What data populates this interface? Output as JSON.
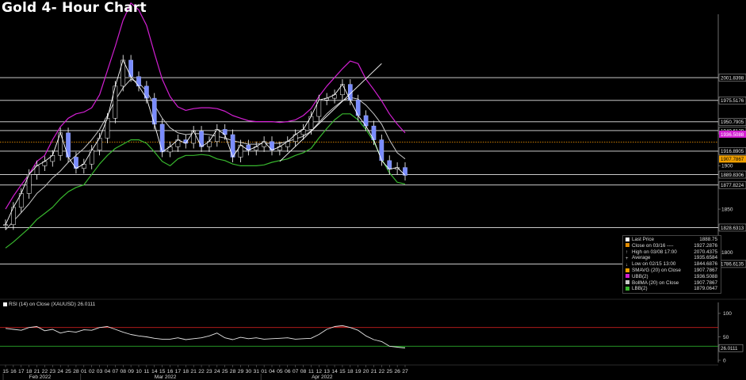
{
  "title": "Gold 4- Hour Chart",
  "colors": {
    "price": "#ffffff",
    "ubb": "#d21fd2",
    "lbb": "#38b82e",
    "sma": "#c8c8c8",
    "trend": "#ffffff",
    "rsi": "#e6e6e6",
    "rsi_upper": "#c81e1e",
    "rsi_lower": "#2aa82a",
    "close_line": "#e08a00",
    "tag_bg": "#ffffff",
    "tag_text": "#000000",
    "tag_sma": "#f0a000",
    "tag_ubb": "#d21fd2"
  },
  "chart_data": {
    "type": "line",
    "title": "Gold 4- Hour Chart",
    "ylim": [
      1755,
      2075
    ],
    "xlabel": "",
    "ylabel": "",
    "ticks": [
      "15",
      "16",
      "17",
      "18",
      "21",
      "22",
      "23",
      "24",
      "25",
      "28",
      "01",
      "02",
      "03",
      "04",
      "07",
      "08",
      "09",
      "10",
      "11",
      "14",
      "15",
      "16",
      "17",
      "18",
      "21",
      "22",
      "23",
      "24",
      "25",
      "28",
      "29",
      "30",
      "31",
      "01",
      "04",
      "05",
      "06",
      "07",
      "08",
      "11",
      "12",
      "13",
      "14",
      "15",
      "18",
      "19",
      "20",
      "21",
      "22",
      "25",
      "26",
      "27"
    ],
    "months": [
      {
        "label": "Feb 2022",
        "tick_index": 4
      },
      {
        "label": "Mar 2022",
        "tick_index": 20
      },
      {
        "label": "Apr 2022",
        "tick_index": 40
      }
    ],
    "y_ticks": [
      1800,
      1850,
      1900
    ],
    "series": [
      {
        "name": "Last Price",
        "values": [
          1832,
          1852,
          1868,
          1890,
          1900,
          1905,
          1912,
          1938,
          1910,
          1897,
          1902,
          1918,
          1932,
          1955,
          1992,
          2022,
          2003,
          1992,
          1978,
          1948,
          1916,
          1922,
          1930,
          1926,
          1940,
          1922,
          1928,
          1942,
          1936,
          1910,
          1924,
          1918,
          1922,
          1928,
          1918,
          1922,
          1928,
          1936,
          1942,
          1957,
          1976,
          1978,
          1982,
          1994,
          1976,
          1958,
          1946,
          1930,
          1906,
          1896,
          1898,
          1889
        ]
      },
      {
        "name": "SMAVG (20)  on Close",
        "values": [
          1826,
          1836,
          1846,
          1856,
          1868,
          1876,
          1886,
          1894,
          1904,
          1912,
          1920,
          1930,
          1942,
          1958,
          1976,
          1990,
          2000,
          1996,
          1986,
          1970,
          1955,
          1944,
          1938,
          1936,
          1937,
          1937,
          1936,
          1934,
          1932,
          1929,
          1927,
          1925,
          1925,
          1926,
          1926,
          1926,
          1928,
          1931,
          1934,
          1940,
          1950,
          1960,
          1968,
          1975,
          1979,
          1977,
          1970,
          1960,
          1948,
          1930,
          1915,
          1908
        ]
      },
      {
        "name": "UBB(2)",
        "values": [
          1850,
          1865,
          1878,
          1890,
          1905,
          1912,
          1930,
          1945,
          1955,
          1960,
          1962,
          1967,
          1982,
          2010,
          2038,
          2068,
          2088,
          2080,
          2062,
          2030,
          2000,
          1980,
          1968,
          1964,
          1966,
          1967,
          1967,
          1966,
          1963,
          1958,
          1955,
          1952,
          1951,
          1951,
          1951,
          1950,
          1951,
          1953,
          1958,
          1966,
          1980,
          1992,
          2002,
          2012,
          2021,
          2018,
          2000,
          1988,
          1975,
          1960,
          1948,
          1938
        ]
      },
      {
        "name": "LBB(2)",
        "values": [
          1805,
          1812,
          1820,
          1828,
          1838,
          1845,
          1852,
          1862,
          1870,
          1875,
          1878,
          1890,
          1902,
          1912,
          1920,
          1925,
          1930,
          1930,
          1926,
          1916,
          1905,
          1900,
          1908,
          1912,
          1912,
          1913,
          1912,
          1908,
          1906,
          1902,
          1900,
          1900,
          1900,
          1901,
          1904,
          1906,
          1908,
          1912,
          1915,
          1920,
          1932,
          1943,
          1953,
          1960,
          1960,
          1953,
          1942,
          1928,
          1908,
          1892,
          1881,
          1879
        ]
      },
      {
        "name": "RSI (14)  on Close (XAUUSD)",
        "values": [
          68,
          66,
          64,
          70,
          72,
          63,
          66,
          58,
          62,
          60,
          65,
          64,
          70,
          72,
          66,
          60,
          55,
          52,
          50,
          47,
          45,
          45,
          48,
          44,
          46,
          48,
          52,
          58,
          48,
          44,
          49,
          46,
          48,
          45,
          46,
          47,
          48,
          45,
          46,
          47,
          55,
          66,
          72,
          74,
          70,
          64,
          52,
          44,
          40,
          30,
          28,
          26
        ]
      }
    ],
    "hlines": [
      {
        "value": 2001.8398,
        "label": "2001.8398"
      },
      {
        "value": 1975.5176,
        "label": "1975.5176"
      },
      {
        "value": 1950.7905,
        "label": "1950.7905"
      },
      {
        "value": 1940.6129,
        "label": "1940.6129"
      },
      {
        "value": 1916.8905,
        "label": "1916.8905"
      },
      {
        "value": 1889.8306,
        "label": "1889.8306"
      },
      {
        "value": 1877.8224,
        "label": "1877.8224"
      },
      {
        "value": 1828.6313,
        "label": "1828.6313"
      },
      {
        "value": 1786.6135,
        "label": "1786.6135"
      }
    ],
    "close_line": {
      "value": 1927.2876
    },
    "trendlines": [
      {
        "from": {
          "index": 35,
          "value": 1905
        },
        "to": {
          "index": 48,
          "value": 2018
        }
      }
    ],
    "price_tags": [
      {
        "value": 1907.7867,
        "label": "1907.7867",
        "kind": "sma"
      },
      {
        "value": 1936.5088,
        "label": "1936.5088",
        "kind": "ubb"
      }
    ],
    "rsi": {
      "ylim": [
        -5,
        110
      ],
      "y_ticks": [
        0,
        50,
        100
      ],
      "upper": 70,
      "lower": 30,
      "last_label": "26.0111"
    }
  },
  "legend": {
    "rows": [
      {
        "label": "Last Price",
        "value": "1888.75",
        "swatch": "#ffffff"
      },
      {
        "label": "Close on 03/16  ----",
        "value": "1927.2876",
        "swatch": "#e08a00"
      },
      {
        "label": "High on 03/08 17:00",
        "value": "2070.4375",
        "swatch": "",
        "glyph": "↑"
      },
      {
        "label": "Average",
        "value": "1935.6584",
        "swatch": "",
        "glyph": "+"
      },
      {
        "label": "Low on 02/15 13:00",
        "value": "1844.6876",
        "swatch": "",
        "glyph": "↓"
      },
      {
        "label": "SMAVG (20)  on Close",
        "value": "1907.7867",
        "swatch": "#f0a000"
      },
      {
        "label": "UBB(2)",
        "value": "1936.5088",
        "swatch": "#d21fd2"
      },
      {
        "label": "BollMA (20)  on Close",
        "value": "1907.7867",
        "swatch": "#c8c8c8"
      },
      {
        "label": "LBB(2)",
        "value": "1879.0647",
        "swatch": "#38b82e"
      }
    ]
  },
  "rsi_legend": {
    "label": "RSI (14)  on Close (XAUUSD)",
    "value": "26.0111"
  }
}
